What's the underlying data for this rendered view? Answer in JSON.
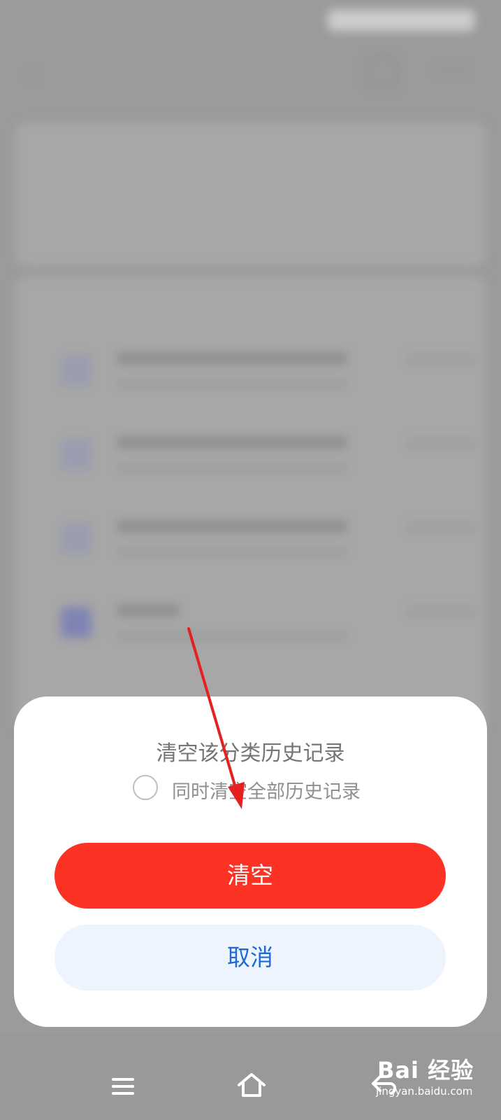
{
  "dialog": {
    "title": "清空该分类历史记录",
    "option_label": "同时清空全部历史记录",
    "option_checked": false,
    "confirm_label": "清空",
    "cancel_label": "取消"
  },
  "colors": {
    "confirm_bg": "#fc3225",
    "cancel_bg": "#edf4fd",
    "cancel_text": "#2168d4",
    "annotation_arrow": "#e52020"
  },
  "bottom_nav": {
    "icons": [
      "menu-icon",
      "home-icon",
      "back-icon"
    ]
  },
  "watermark": {
    "brand": "Bai  经验",
    "url": "jingyan.baidu.com"
  }
}
